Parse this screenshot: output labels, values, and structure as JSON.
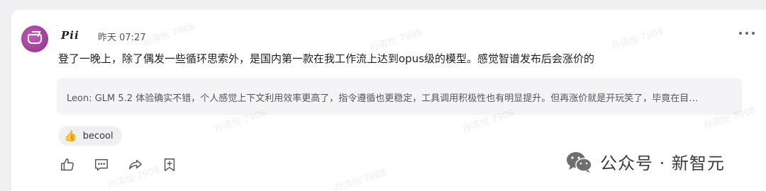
{
  "comment": {
    "username": "Pii",
    "timestamp": "昨天 07:27",
    "text": "登了一晚上，除了偶发一些循环思索外，是国内第一款在我工作流上达到opus级的模型。感觉智谱发布后会涨价的"
  },
  "quoted_reply": {
    "author": "Leon:",
    "text": " GLM 5.2 体验确实不错，个人感觉上下文利用效率更高了，指令遵循也更稳定，工具调用积极性也有明显提升。但再涨价就是开玩笑了，毕竟在目…"
  },
  "reaction": {
    "emoji": "👍",
    "label": "becool"
  },
  "actions": [
    "like-icon",
    "comment-icon",
    "share-icon",
    "bookmark-icon"
  ],
  "brand": {
    "text": "公众号 · 新智元"
  },
  "watermark": {
    "text": "孙清怡 7908"
  }
}
